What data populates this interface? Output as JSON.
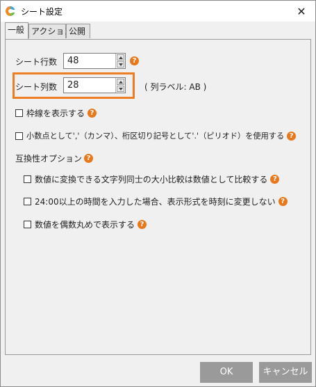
{
  "window": {
    "title": "シート設定",
    "close_glyph": "✕",
    "app_icon": "app-logo-icon"
  },
  "tabs": [
    {
      "label": "一般"
    },
    {
      "label": "アクション"
    },
    {
      "label": "公開"
    }
  ],
  "general": {
    "row_count_label": "シート行数",
    "row_count_value": "48",
    "col_count_label": "シート列数",
    "col_count_value": "28",
    "col_label_info": "( 列ラベル: AB )",
    "gridlines_label": "枠線を表示する",
    "gridlines_checked": false,
    "decimal_label": "小数点として','（カンマ）、桁区切り記号として'.'（ピリオド）を使用する",
    "decimal_checked": false,
    "compat_label": "互換性オプション",
    "compat_options": [
      {
        "label": "数値に変換できる文字列同士の大小比較は数値として比較する",
        "checked": false
      },
      {
        "label": "24:00以上の時間を入力した場合、表示形式を時刻に変更しない",
        "checked": false
      },
      {
        "label": "数値を偶数丸めで表示する",
        "checked": false
      }
    ],
    "help_glyph": "?"
  },
  "footer": {
    "ok_label": "OK",
    "cancel_label": "キャンセル"
  },
  "colors": {
    "accent": "#ec7d22",
    "help": "#e8781a",
    "button": "#9a9a9a"
  }
}
